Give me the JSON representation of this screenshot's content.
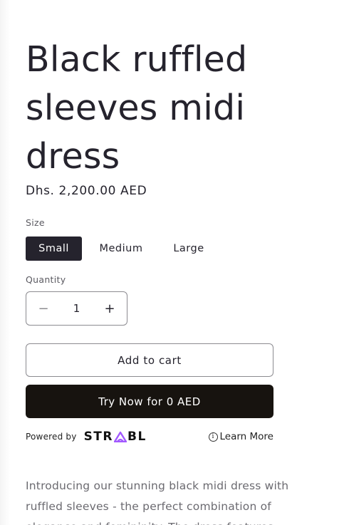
{
  "product": {
    "title": "Black ruffled sleeves midi dress",
    "price": "Dhs. 2,200.00 AED"
  },
  "size": {
    "label": "Size",
    "options": [
      "Small",
      "Medium",
      "Large"
    ],
    "selected": "Small"
  },
  "quantity": {
    "label": "Quantity",
    "value": "1",
    "minus": "−",
    "plus": "+"
  },
  "actions": {
    "add_to_cart": "Add to cart",
    "try_now": "Try Now for 0 AED"
  },
  "strabl": {
    "powered_by": "Powered by",
    "logo_text_left": "STR",
    "logo_text_right": "BL",
    "info_glyph": "i",
    "learn_more": "Learn More",
    "accent": "#a259ff"
  },
  "description": {
    "line1": "Introducing our stunning black midi dress with",
    "line2": "ruffled sleeves - the perfect combination of",
    "line3": "elegance and femininity. The dress features"
  },
  "colors": {
    "selected_bg": "#25232d",
    "primary_button": "#17130f",
    "text": "#25232d",
    "muted_text": "#6b6a70"
  }
}
